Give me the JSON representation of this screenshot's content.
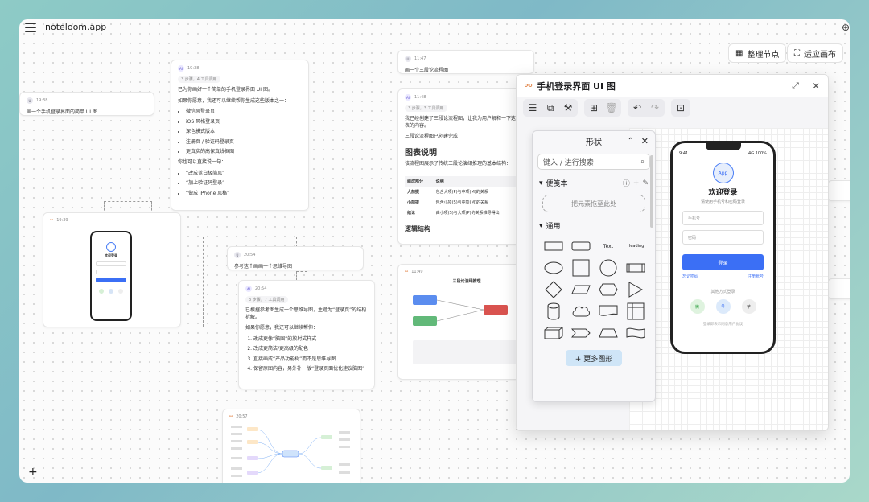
{
  "app": {
    "title": "noteloom.app"
  },
  "toolbar": {
    "organize": "整理节点",
    "fit": "适应画布"
  },
  "cards": {
    "c1": {
      "time": "19:38",
      "text": "画一个手机登录界面的简单 UI 图"
    },
    "c2": {
      "time": "19:38",
      "steps": "3 步骤，4 工具调用",
      "intro": "已为你画好一个简单的手机登录界面 UI 图。",
      "offer": "如果你愿意，我还可以继续帮你生成这些版本之一：",
      "items": [
        "微信风登录页",
        "iOS 风格登录页",
        "深色模式版本",
        "注册页 / 验证码登录页",
        "更真实的高保真线框图"
      ],
      "hint": "你也可以直接说一句：",
      "quotes": [
        "“改成蓝白极简风”",
        "“加上验证码登录”",
        "“做成 iPhone 风格”"
      ]
    },
    "c3": {
      "time": "19:39",
      "title": "欢迎登录"
    },
    "c4": {
      "time": "20:54",
      "text": "参考这个画画一个思维导图"
    },
    "c5": {
      "time": "20:54",
      "steps": "3 步骤，7 工具调用",
      "intro": "已根据参考图生成一个思维导图，主题为“登录页”的结构拆解。",
      "offer": "如果你愿意，我还可以继续帮你：",
      "items": [
        "改成更像“脑图”的放射式样式",
        "改成更简洁/更高级的配色",
        "直接画成“产品功能树”而不是思维导图",
        "保留原图内容，另外补一版“登录页面优化建议脑图”"
      ]
    },
    "c6": {
      "time": "20:57"
    },
    "c7": {
      "time": "11:47",
      "text": "画一个三段论流程图"
    },
    "c8": {
      "time": "11:48",
      "steps": "3 步骤，3 工具调用",
      "intro": "我已经创建了三段论流程图，让我为用户解释一下这个图表的内容。",
      "done": "三段论流程图已创建完成！",
      "h": "图表说明",
      "desc": "该流程图展示了传统三段论演绎推理的基本结构：",
      "th": [
        "组成部分",
        "说明"
      ],
      "rows": [
        [
          "大前提",
          "包含大项(P)与中项(M)的关系"
        ],
        [
          "小前提",
          "包含小项(S)与中项(M)的关系"
        ],
        [
          "结论",
          "由小项(S)与大项(P)的关系推导得出"
        ]
      ],
      "h2": "逻辑结构"
    },
    "c9": {
      "time": "11:49",
      "title": "三段论演绎推理"
    }
  },
  "panel": {
    "title": "手机登录界面 UI 图"
  },
  "shapes": {
    "title": "形状",
    "search": "键入 / 进行搜索",
    "notes": "便笺本",
    "drop": "把元素拖至此处",
    "general": "通用",
    "text": "Text",
    "heading": "Heading",
    "more": "+ 更多图形"
  },
  "phone": {
    "time": "9:41",
    "signal": "4G 100%",
    "logo": "App",
    "title": "欢迎登录",
    "subtitle": "请使用手机号和密码登录",
    "phone_ph": "手机号",
    "pwd_ph": "密码",
    "login": "登录",
    "forgot": "忘记密码",
    "register": "注册账号",
    "other": "其他方式登录",
    "s1": "微",
    "s2": "Q",
    "s3": "苹",
    "terms": "登录即表示同意用户协议"
  }
}
